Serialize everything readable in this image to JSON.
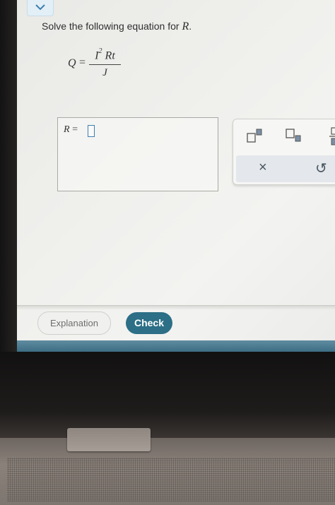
{
  "question": {
    "prompt_prefix": "Solve the following equation for ",
    "target_variable": "R",
    "prompt_suffix": "."
  },
  "equation": {
    "lhs": "Q",
    "equals": "=",
    "numerator_base": "I",
    "numerator_exponent": "2",
    "numerator_rest": "Rt",
    "denominator": "J"
  },
  "answer": {
    "label_variable": "R",
    "label_equals": "=",
    "value": ""
  },
  "toolbar": {
    "close_symbol": "×",
    "undo_symbol": "↺"
  },
  "actions": {
    "explanation_label": "Explanation",
    "check_label": "Check"
  },
  "colors": {
    "accent": "#2c6f86",
    "input_border": "#3d7fb1"
  }
}
